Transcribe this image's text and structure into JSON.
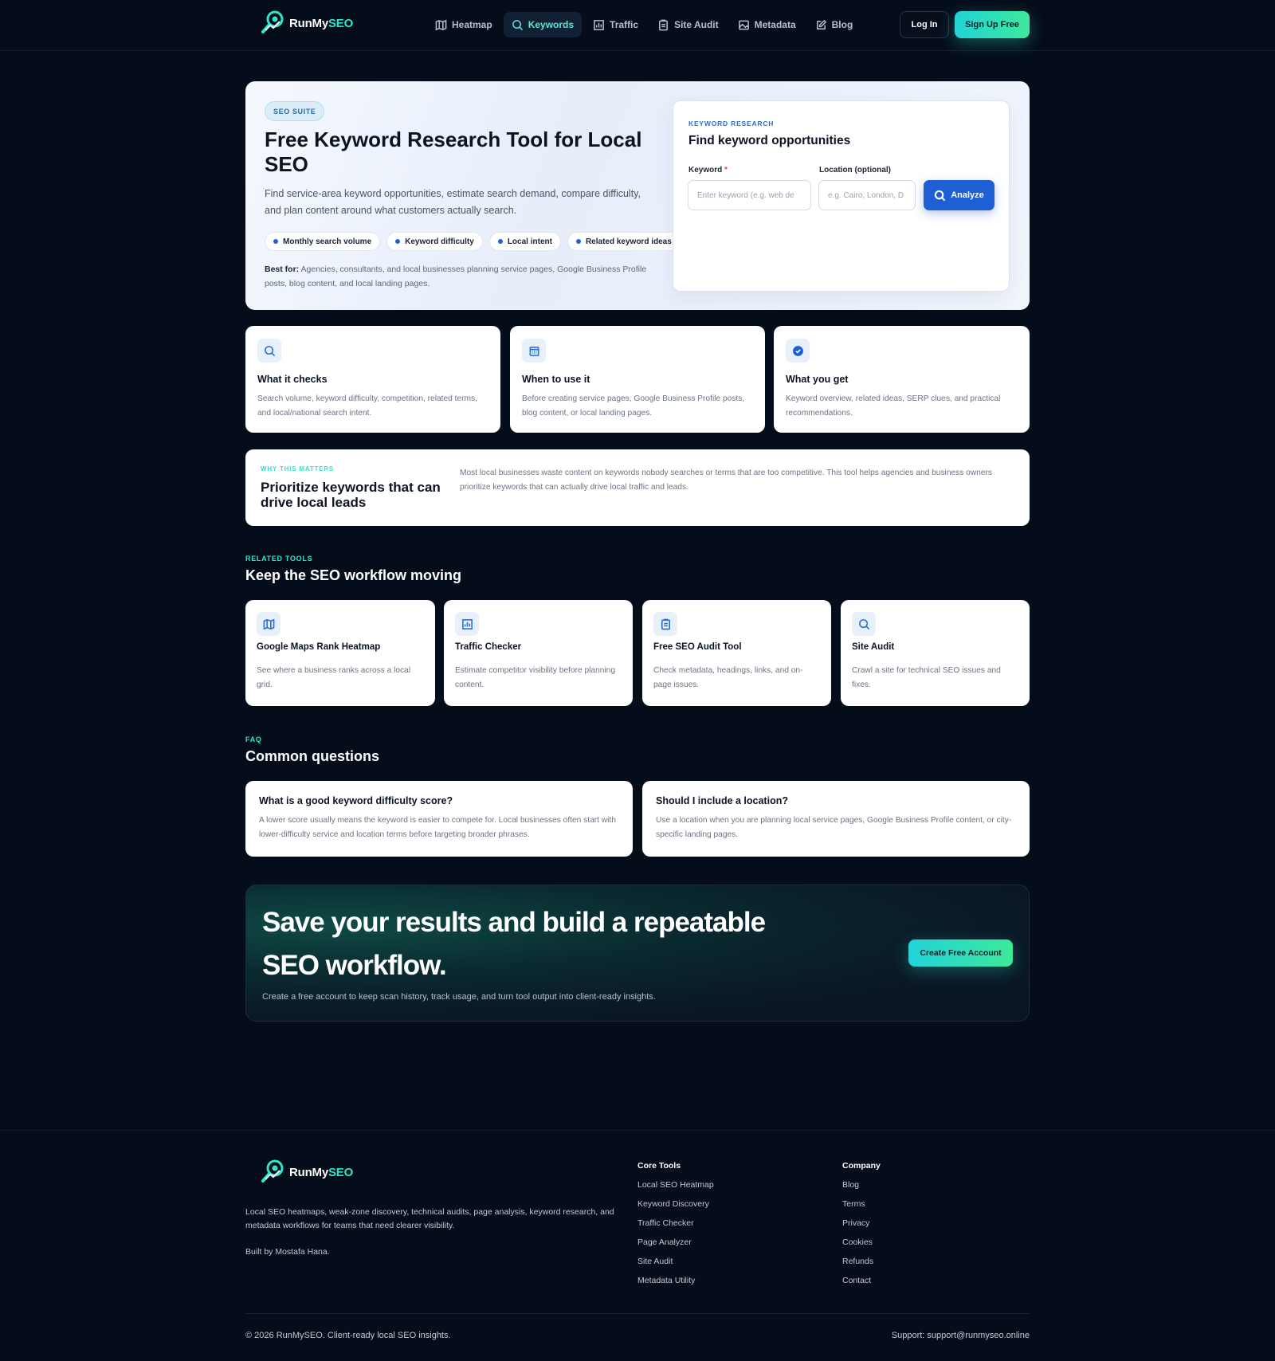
{
  "brand": {
    "name_a": "RunMy",
    "name_b": "SEO",
    "accent": "#2ee6c9",
    "primary_blue": "#1f5fd6"
  },
  "nav": {
    "items": [
      {
        "label": "Heatmap",
        "icon": "map-icon",
        "active": false
      },
      {
        "label": "Keywords",
        "icon": "search-icon",
        "active": true
      },
      {
        "label": "Traffic",
        "icon": "chart-icon",
        "active": false
      },
      {
        "label": "Site Audit",
        "icon": "clipboard-icon",
        "active": false
      },
      {
        "label": "Metadata",
        "icon": "image-icon",
        "active": false
      },
      {
        "label": "Blog",
        "icon": "edit-icon",
        "active": false
      }
    ],
    "login": "Log In",
    "signup": "Sign Up Free"
  },
  "hero": {
    "badge": "SEO SUITE",
    "title": "Free Keyword Research Tool for Local SEO",
    "description": "Find service-area keyword opportunities, estimate search demand, compare difficulty, and plan content around what customers actually search.",
    "chips": [
      "Monthly search volume",
      "Keyword difficulty",
      "Local intent",
      "Related keyword ideas"
    ],
    "best_for_label": "Best for:",
    "best_for_text": "Agencies, consultants, and local businesses planning service pages, Google Business Profile posts, blog content, and local landing pages."
  },
  "research_card": {
    "eyebrow": "KEYWORD RESEARCH",
    "title": "Find keyword opportunities",
    "keyword_label": "Keyword",
    "required_mark": "*",
    "keyword_value": "",
    "keyword_placeholder": "Enter keyword (e.g. web de",
    "location_label": "Location (optional)",
    "location_value": "",
    "location_placeholder": "e.g. Cairo, London, D",
    "analyze": "Analyze"
  },
  "info_cards": [
    {
      "icon": "search-icon",
      "title": "What it checks",
      "text": "Search volume, keyword difficulty, competition, related terms, and local/national search intent."
    },
    {
      "icon": "calendar-icon",
      "title": "When to use it",
      "text": "Before creating service pages, Google Business Profile posts, blog content, or local landing pages."
    },
    {
      "icon": "check-circle-icon",
      "title": "What you get",
      "text": "Keyword overview, related ideas, SERP clues, and practical recommendations."
    }
  ],
  "why": {
    "eyebrow": "WHY THIS MATTERS",
    "title": "Prioritize keywords that can drive local leads",
    "text": "Most local businesses waste content on keywords nobody searches or terms that are too competitive. This tool helps agencies and business owners prioritize keywords that can actually drive local traffic and leads."
  },
  "related": {
    "eyebrow": "RELATED TOOLS",
    "title": "Keep the SEO workflow moving",
    "tools": [
      {
        "icon": "map-icon",
        "title": "Google Maps Rank Heatmap",
        "text": "See where a business ranks across a local grid."
      },
      {
        "icon": "chart-icon",
        "title": "Traffic Checker",
        "text": "Estimate competitor visibility before planning content."
      },
      {
        "icon": "clipboard-icon",
        "title": "Free SEO Audit Tool",
        "text": "Check metadata, headings, links, and on-page issues."
      },
      {
        "icon": "search-icon",
        "title": "Site Audit",
        "text": "Crawl a site for technical SEO issues and fixes."
      }
    ]
  },
  "faq": {
    "eyebrow": "FAQ",
    "title": "Common questions",
    "items": [
      {
        "q": "What is a good keyword difficulty score?",
        "a": "A lower score usually means the keyword is easier to compete for. Local businesses often start with lower-difficulty service and location terms before targeting broader phrases."
      },
      {
        "q": "Should I include a location?",
        "a": "Use a location when you are planning local service pages, Google Business Profile content, or city-specific landing pages."
      }
    ]
  },
  "cta": {
    "title": "Save your results and build a repeatable SEO workflow.",
    "text": "Create a free account to keep scan history, track usage, and turn tool output into client-ready insights.",
    "button": "Create Free Account"
  },
  "footer": {
    "description": "Local SEO heatmaps, weak-zone discovery, technical audits, page analysis, keyword research, and metadata workflows for teams that need clearer visibility.",
    "built_by": "Built by Mostafa Hana.",
    "core_tools_heading": "Core Tools",
    "core_tools": [
      "Local SEO Heatmap",
      "Keyword Discovery",
      "Traffic Checker",
      "Page Analyzer",
      "Site Audit",
      "Metadata Utility"
    ],
    "company_heading": "Company",
    "company": [
      "Blog",
      "Terms",
      "Privacy",
      "Cookies",
      "Refunds",
      "Contact"
    ],
    "copyright": "© 2026 RunMySEO. Client-ready local SEO insights.",
    "support": "Support: support@runmyseo.online"
  }
}
